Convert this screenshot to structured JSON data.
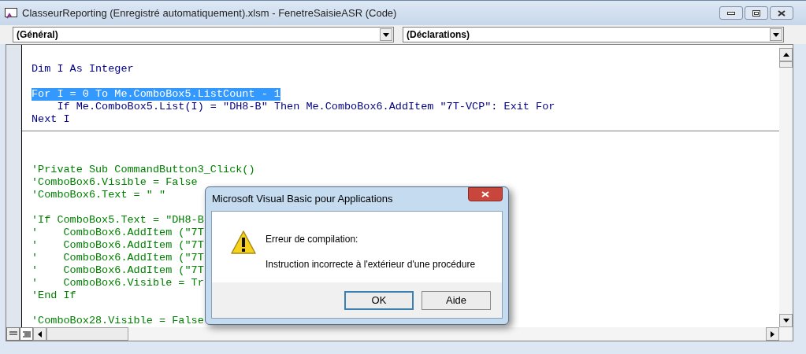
{
  "window": {
    "title": "ClasseurReporting (Enregistré automatiquement).xlsm - FenetreSaisieASR (Code)"
  },
  "object_dropdown": {
    "value": "(Général)"
  },
  "procedure_dropdown": {
    "value": "(Déclarations)"
  },
  "code_lines": [
    {
      "kind": "blank"
    },
    {
      "kind": "code",
      "selected": false,
      "divider_after": false,
      "tokens": [
        {
          "kind": "keyword",
          "text": "Dim "
        },
        {
          "kind": "plain",
          "text": "I "
        },
        {
          "kind": "keyword",
          "text": "As Integer"
        }
      ]
    },
    {
      "kind": "blank"
    },
    {
      "kind": "code",
      "selected": true,
      "divider_after": false,
      "text": "For I = 0 To Me.ComboBox5.ListCount - 1"
    },
    {
      "kind": "code",
      "selected": false,
      "divider_after": false,
      "tokens": [
        {
          "kind": "keyword",
          "text": "    If "
        },
        {
          "kind": "plain",
          "text": "Me.ComboBox5.List(I) = \"DH8-B\" "
        },
        {
          "kind": "keyword",
          "text": "Then "
        },
        {
          "kind": "plain",
          "text": "Me.ComboBox6.AddItem \"7T-VCP\": "
        },
        {
          "kind": "keyword",
          "text": "Exit For"
        }
      ]
    },
    {
      "kind": "code",
      "selected": false,
      "divider_after": true,
      "tokens": [
        {
          "kind": "keyword",
          "text": "Next "
        },
        {
          "kind": "plain",
          "text": "I"
        }
      ]
    },
    {
      "kind": "blank"
    },
    {
      "kind": "blank"
    },
    {
      "kind": "blank"
    },
    {
      "kind": "comment",
      "text": "'Private Sub CommandButton3_Click()"
    },
    {
      "kind": "comment",
      "text": "'ComboBox6.Visible = False"
    },
    {
      "kind": "comment",
      "text": "'ComboBox6.Text = \" \""
    },
    {
      "kind": "blank"
    },
    {
      "kind": "comment",
      "text": "'If ComboBox5.Text = \"DH8-B"
    },
    {
      "kind": "comment",
      "text": "'    ComboBox6.AddItem (\"7T"
    },
    {
      "kind": "comment",
      "text": "'    ComboBox6.AddItem (\"7T"
    },
    {
      "kind": "comment",
      "text": "'    ComboBox6.AddItem (\"7T"
    },
    {
      "kind": "comment",
      "text": "'    ComboBox6.AddItem (\"7T"
    },
    {
      "kind": "comment",
      "text": "'    ComboBox6.Visible = Tr"
    },
    {
      "kind": "comment",
      "text": "'End If"
    },
    {
      "kind": "blank"
    },
    {
      "kind": "comment",
      "text": "'ComboBox28.Visible = False"
    }
  ],
  "view_buttons": [
    {
      "kind": "procedure",
      "selected": false
    },
    {
      "kind": "module",
      "selected": true
    }
  ],
  "dialog": {
    "title": "Microsoft Visual Basic pour Applications",
    "heading": "Erreur de compilation:",
    "message": "Instruction incorrecte à l'extérieur d'une procédure",
    "buttons": [
      {
        "label": "OK",
        "default": true
      },
      {
        "label": "Aide",
        "default": false
      }
    ]
  }
}
